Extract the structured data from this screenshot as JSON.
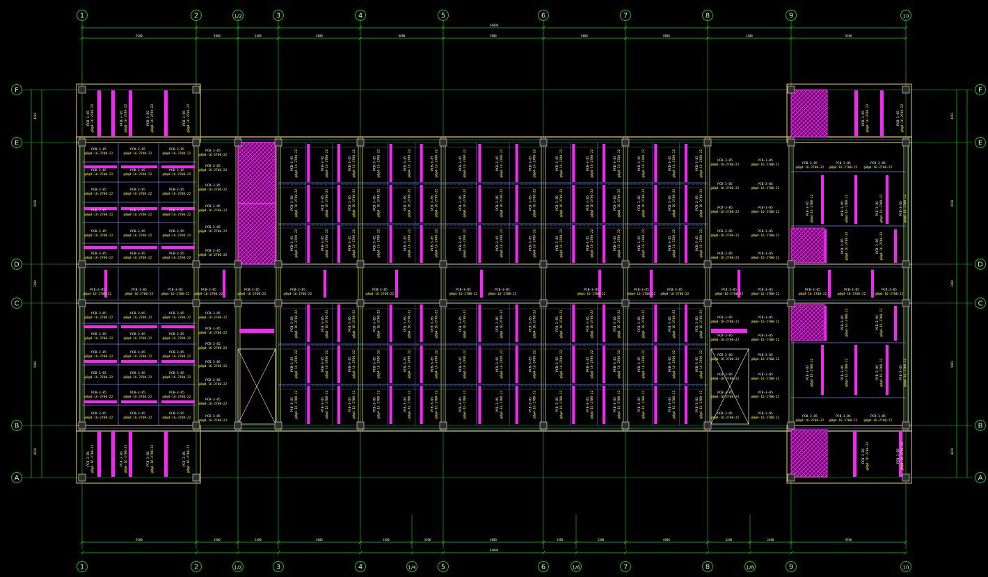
{
  "colors": {
    "background": "#000000",
    "grid": "#00e000",
    "wall": "#f0d060",
    "beam": "#00c8ff",
    "slab": "#8080ff",
    "rebar": "#ff20ff",
    "text_white": "#ffffff",
    "text_yellow": "#ffff40",
    "column": "#d0d0d0"
  },
  "axes": {
    "top": [
      {
        "label": "1"
      },
      {
        "label": "2"
      },
      {
        "label": "1/2"
      },
      {
        "label": "3"
      },
      {
        "label": "4"
      },
      {
        "label": "5"
      },
      {
        "label": "6"
      },
      {
        "label": "7"
      },
      {
        "label": "8"
      },
      {
        "label": "9"
      },
      {
        "label": "10"
      }
    ],
    "bottom": [
      {
        "label": "1"
      },
      {
        "label": "2"
      },
      {
        "label": "1/2"
      },
      {
        "label": "3"
      },
      {
        "label": "4"
      },
      {
        "label": "1/4"
      },
      {
        "label": "5"
      },
      {
        "label": "6"
      },
      {
        "label": "1/6"
      },
      {
        "label": "7"
      },
      {
        "label": "8"
      },
      {
        "label": "1/8"
      },
      {
        "label": "9"
      },
      {
        "label": "10"
      }
    ],
    "rows_left": [
      {
        "label": "F"
      },
      {
        "label": "E"
      },
      {
        "label": "D"
      },
      {
        "label": "C"
      },
      {
        "label": "B"
      },
      {
        "label": "A"
      }
    ],
    "rows_right": [
      {
        "label": "F"
      },
      {
        "label": "E"
      },
      {
        "label": "D"
      },
      {
        "label": "C"
      },
      {
        "label": "B"
      },
      {
        "label": "A"
      }
    ]
  },
  "dimensions": {
    "top_total": "64800",
    "top_segments": [
      "9200",
      "4000",
      "2400",
      "6600",
      "6600",
      "6600",
      "6600",
      "6600",
      "4200",
      "9200"
    ],
    "bottom_total": "64800",
    "bottom_segments": [
      "9200",
      "3300",
      "2400",
      "6600",
      "3300",
      "3300",
      "6600",
      "3300",
      "3300",
      "6600",
      "4200",
      "2400",
      "9200"
    ],
    "left_vertical": [
      "4200",
      "9900",
      "3000",
      "9900",
      "4200"
    ],
    "right_vertical": [
      "4200",
      "9900",
      "3000",
      "9900",
      "4200"
    ]
  },
  "slab_label": {
    "code": "PCB-3-85",
    "rebar": "@8@4-16-2700-22"
  }
}
